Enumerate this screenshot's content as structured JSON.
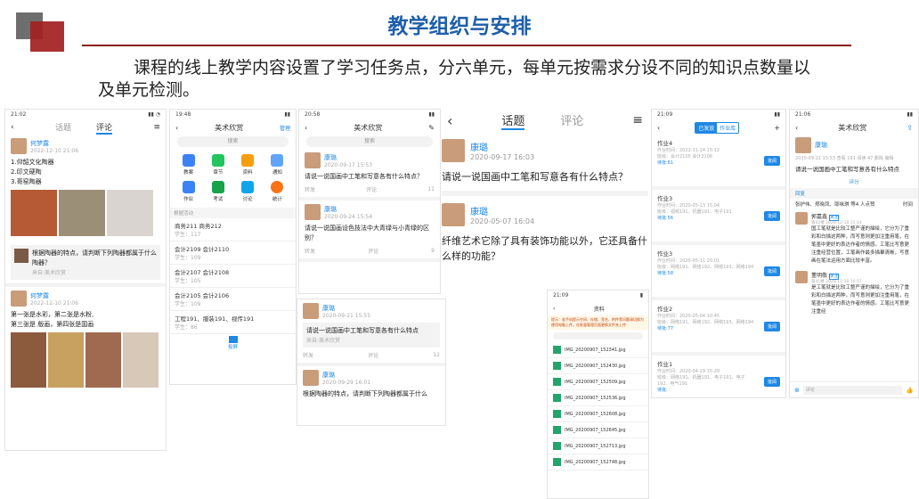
{
  "slide": {
    "title": "教学组织与安排",
    "intro": "课程的线上教学内容设置了学习任务点，分六单元，每单元按需求分设不同的知识点数量以及单元检测。"
  },
  "s1": {
    "time": "21:02",
    "tabs": [
      "话题",
      "评论"
    ],
    "p1": {
      "name": "何梦露",
      "date": "2022-12-10 21:06",
      "lines": [
        "1.仰韶文化陶器",
        "2.印文硬陶",
        "3.哥窑陶器"
      ],
      "link": "根据陶器的特点，请判断下列陶器都属于什么陶器？",
      "link_sub": "来自:美术欣赏"
    },
    "p2": {
      "name": "何梦露",
      "date": "2022-12-10 21:06",
      "lines": [
        "第一张是水彩，第二张是水粉,",
        "第三张是 版画，第四张是国画"
      ]
    }
  },
  "s2": {
    "time": "19:48",
    "title": "美术欣赏",
    "manage": "管理",
    "search": "搜索",
    "icons": [
      "教案",
      "章节",
      "资料",
      "通知",
      "作业",
      "考试",
      "讨论",
      "统计"
    ],
    "section": "根据活动",
    "groups": [
      {
        "t": "商务211 商务212",
        "s": "学生：117"
      },
      {
        "t": "会计2109 会计2110",
        "s": "学生：109"
      },
      {
        "t": "会计2107 会计2108",
        "s": "学生：105"
      },
      {
        "t": "会计2105 会计2106",
        "s": "学生：109"
      },
      {
        "t": "工程191、服装191、视传191",
        "s": "学生：86"
      }
    ],
    "bottom": "投屏"
  },
  "s3": {
    "time": "20:58",
    "title": "美术欣赏",
    "search": "搜索",
    "posts": [
      {
        "name": "康璐",
        "date": "2020-09-17 15:53",
        "text": "请说一说国画中工笔和写意各有什么特点？",
        "n": "11"
      },
      {
        "name": "康璐",
        "date": "2020-09-24 15:54",
        "text": "请说一说国画设色技法中大青绿与小青绿的区别？",
        "n": "9"
      }
    ],
    "actions": [
      "转发",
      "评论"
    ]
  },
  "s3b": {
    "name": "康璐",
    "date": "2020-09-21 15:55",
    "text": "请说一说国画中工笔和写意各有什么特点",
    "sub": "来自:美术欣赏",
    "n": "12",
    "p2name": "康璐",
    "p2date": "2020-09-29 16:01",
    "p2text": "根据陶器的特点，请判断下列陶器都属于什么"
  },
  "s4": {
    "tabs": [
      "话题",
      "评论"
    ],
    "p1": {
      "name": "康璐",
      "date": "2020-09-17 16:03",
      "text": "请说一说国画中工笔和写意各有什么特点？"
    },
    "p2": {
      "name": "康璐",
      "date": "2020-05-07 16:04",
      "text": "纤维艺术它除了具有装饰功能以外，它还具备什么样的功能？"
    }
  },
  "s5": {
    "time": "21:07",
    "title": "资料",
    "notice": "提示：若手机提示空间、存储、签名、附件等问题请切换为使用电脑上传，在批量管理页面更换文件夹上传",
    "files": [
      "IMG_20200907_152341.jpg",
      "IMG_20200907_152430.jpg",
      "IMG_20200907_152509.jpg",
      "IMG_20200907_152536.jpg",
      "IMG_20200907_152608.jpg",
      "IMG_20200907_152645.jpg",
      "IMG_20200907_152713.jpg",
      "IMG_20200907_152748.jpg"
    ]
  },
  "s6": {
    "time": "21:09",
    "tabs": [
      "已发放",
      "作业库"
    ],
    "items": [
      {
        "t": "作业4",
        "d": "作业时间：2022-11-14 15:12",
        "c": "班级：会计2105 会计2106",
        "n": "待批:61"
      },
      {
        "t": "作业3",
        "d": "作业时间：2020-05-13 15:04",
        "c": "班级：视频191、机器191、电子191",
        "n": "待批:56"
      },
      {
        "t": "作业3",
        "d": "作业时间：2020-05-11 20:01",
        "c": "班级：网络191、网络192、网络193、网络194",
        "n": "待批:58"
      },
      {
        "t": "作业2",
        "d": "作业时间：2020-05-04 10:45",
        "c": "班级：网络191、网络192、网络193、网络194",
        "n": "待批:77"
      },
      {
        "t": "作业1",
        "d": "作业时间：2020-04-29 15:29",
        "c": "班级：网络191、机器191、电子191、电子192、电气191",
        "n": "待批:"
      }
    ],
    "btn": "批阅"
  },
  "s7": {
    "time": "21:06",
    "title": "美术欣赏",
    "name": "康璐",
    "meta": "2020-09-21 15:53  查看 191  阅读 47  删除  编辑",
    "q": "请说一说国画中工笔和写意各有什么特点",
    "eval": "评分",
    "reply_label": "回复",
    "likes": "张护伟、郑晓凤、耶咏琪 等4 人点赞",
    "sort": "时间",
    "c1": {
      "name": "郭嘉鑫",
      "tag": "关注",
      "date": "第42楼  2020-12-10 11:14",
      "text": "国工笔就是比较工整严谨的描绘，它分为了重彩和白描这两种，而写意则更加注重用笔，在笔墨中更好的表达作者的情感。工笔比写意更注重经营位置，工笔画作最多描摹清晰，写意画在笔法运用方面比较丰富。"
    },
    "c2": {
      "name": "董明敬",
      "tag": "关注",
      "date": "第41楼  2020-12-10 10:57",
      "text": "是工笔就是比较工整严谨的描绘，它分为了重彩和白描这两种，而写意则更加注重用笔，在笔墨中更好的表达作者的情感。工笔比写意更注重经"
    },
    "input": "评论"
  }
}
